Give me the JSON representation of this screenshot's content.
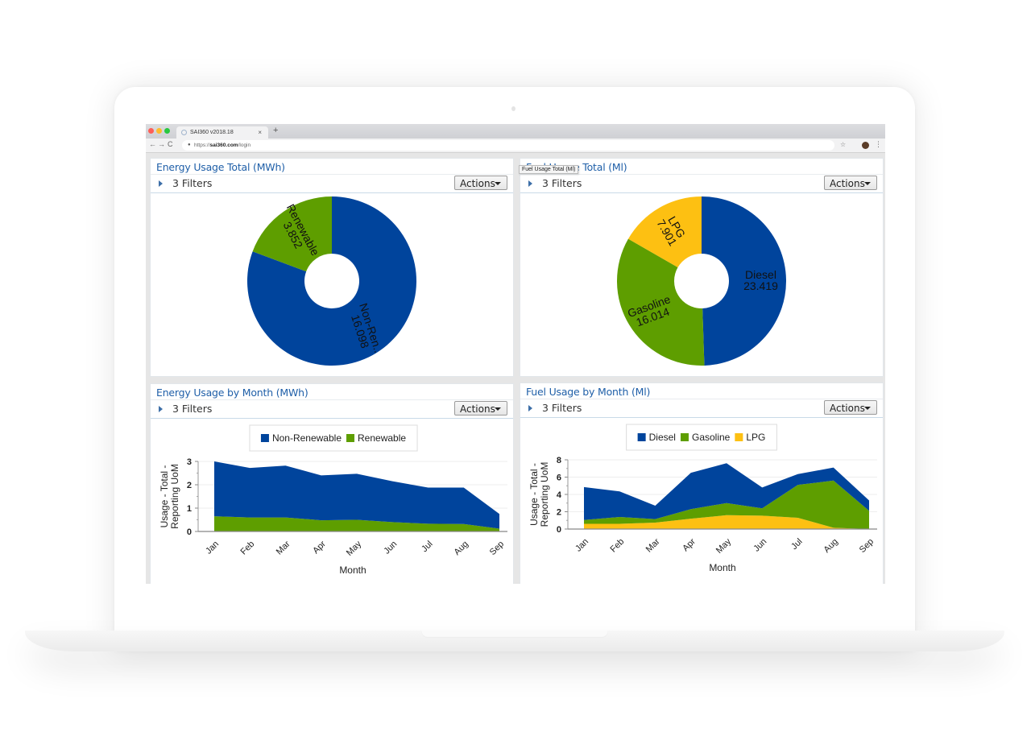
{
  "browser": {
    "tab_title": "SAI360 v2018.18",
    "tab_close": "×",
    "new_tab": "+",
    "nav_back": "←",
    "nav_forward": "→",
    "nav_reload": "C",
    "url_scheme": "https://",
    "url_host": "sai360.com",
    "url_path": "/login",
    "star_icon": "☆",
    "menu_icon": "⋮",
    "lock_icon": "🔒"
  },
  "tooltip": "Fuel Usage Total (Ml)",
  "panels": [
    {
      "title": "Energy Usage Total (MWh)",
      "filters": "3 Filters",
      "actions": "Actions"
    },
    {
      "title": "Fuel Usage Total (Ml)",
      "filters": "3 Filters",
      "actions": "Actions"
    },
    {
      "title": "Energy Usage by Month (MWh)",
      "filters": "3 Filters",
      "actions": "Actions"
    },
    {
      "title": "Fuel Usage by Month (Ml)",
      "filters": "3 Filters",
      "actions": "Actions"
    }
  ],
  "colors": {
    "blue": "#00449c",
    "green": "#5e9e00",
    "yellow": "#fdc012",
    "title_blue": "#1f5fa8"
  },
  "chart_data": [
    {
      "type": "pie",
      "title": "Energy Usage Total (MWh)",
      "donut": true,
      "slices": [
        {
          "label": "Non-Ren..",
          "full_label": "Non-Renewable",
          "value": 16.098,
          "display": "16.098",
          "color": "#00449c"
        },
        {
          "label": "Renewable",
          "value": 3.852,
          "display": "3.852",
          "color": "#5e9e00"
        }
      ]
    },
    {
      "type": "pie",
      "title": "Fuel Usage Total (Ml)",
      "donut": true,
      "slices": [
        {
          "label": "Diesel",
          "value": 23.419,
          "display": "23.419",
          "color": "#00449c"
        },
        {
          "label": "Gasoline",
          "value": 16.014,
          "display": "16.014",
          "color": "#5e9e00"
        },
        {
          "label": "LPG",
          "value": 7.901,
          "display": "7.901",
          "color": "#fdc012"
        }
      ]
    },
    {
      "type": "area",
      "stacked": true,
      "title": "Energy Usage by Month (MWh)",
      "xlabel": "Month",
      "ylabel": "Usage - Total - Reporting UoM",
      "ylim": [
        0,
        3
      ],
      "yticks": [
        0,
        1,
        2,
        3
      ],
      "grid": true,
      "legend": "top-center",
      "categories": [
        "Jan",
        "Feb",
        "Mar",
        "Apr",
        "May",
        "Jun",
        "Jul",
        "Aug",
        "Sep"
      ],
      "series": [
        {
          "name": "Renewable",
          "color": "#5e9e00",
          "values": [
            0.65,
            0.6,
            0.6,
            0.48,
            0.5,
            0.4,
            0.33,
            0.32,
            0.12
          ]
        },
        {
          "name": "Non-Renewable",
          "color": "#00449c",
          "values": [
            2.35,
            2.12,
            2.22,
            1.92,
            1.97,
            1.75,
            1.55,
            1.56,
            0.63
          ]
        }
      ],
      "legend_order": [
        "Non-Renewable",
        "Renewable"
      ]
    },
    {
      "type": "area",
      "stacked": true,
      "title": "Fuel Usage by Month (Ml)",
      "xlabel": "Month",
      "ylabel": "Usage - Total - Reporting UoM",
      "ylim": [
        0,
        8
      ],
      "yticks": [
        0,
        2,
        4,
        6,
        8
      ],
      "grid": true,
      "legend": "top-center",
      "categories": [
        "Jan",
        "Feb",
        "Mar",
        "Apr",
        "May",
        "Jun",
        "Jul",
        "Aug",
        "Sep"
      ],
      "series": [
        {
          "name": "LPG",
          "color": "#fdc012",
          "values": [
            0.6,
            0.6,
            0.75,
            1.2,
            1.6,
            1.55,
            1.3,
            0.15,
            0
          ]
        },
        {
          "name": "Gasoline",
          "color": "#5e9e00",
          "values": [
            0.45,
            0.8,
            0.4,
            1.1,
            1.4,
            0.85,
            3.8,
            5.45,
            2.1
          ]
        },
        {
          "name": "Diesel",
          "color": "#00449c",
          "values": [
            3.8,
            2.95,
            1.55,
            4.2,
            4.6,
            2.4,
            1.25,
            1.5,
            1.2
          ]
        }
      ],
      "legend_order": [
        "Diesel",
        "Gasoline",
        "LPG"
      ]
    }
  ]
}
